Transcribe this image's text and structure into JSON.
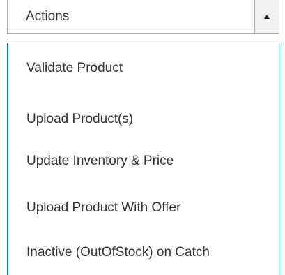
{
  "actions_select": {
    "label": "Actions"
  },
  "actions_menu": {
    "items": [
      {
        "label": "Validate Product"
      },
      {
        "label": "Upload Product(s)"
      },
      {
        "label": "Update Inventory & Price"
      },
      {
        "label": "Upload Product With Offer"
      },
      {
        "label": "Inactive (OutOfStock) on Catch"
      }
    ]
  },
  "colors": {
    "menu_border": "#007bdb",
    "select_border": "#adadad",
    "text": "#333333"
  },
  "icons": {
    "toggle": "caret-up-icon"
  }
}
